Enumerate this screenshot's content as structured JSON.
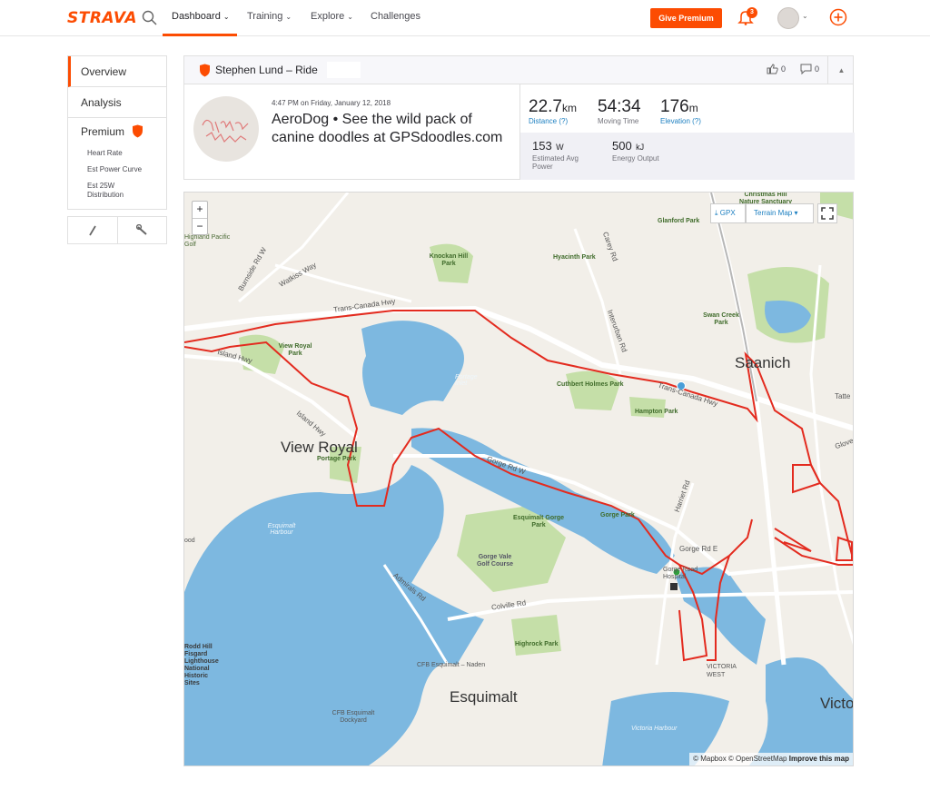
{
  "nav": {
    "logo": "STRAVA",
    "items": [
      "Dashboard",
      "Training",
      "Explore",
      "Challenges"
    ],
    "give_premium": "Give Premium",
    "notification_count": "3",
    "accent": "#fc4c02"
  },
  "sidebar": {
    "items": [
      "Overview",
      "Analysis",
      "Premium"
    ],
    "premium_sub": [
      "Heart Rate",
      "Est Power Curve",
      "Est 25W Distribution"
    ]
  },
  "activity": {
    "athlete_title": "Stephen Lund – Ride",
    "kudos_count": "0",
    "comment_count": "0",
    "date": "4:47 PM on Friday, January 12, 2018",
    "name": "AeroDog • See the wild pack of canine doodles at GPSdoodles.com",
    "stats": {
      "distance": {
        "value": "22.7",
        "unit": "km",
        "label": "Distance (?)"
      },
      "moving_time": {
        "value": "54:34",
        "label": "Moving Time"
      },
      "elevation": {
        "value": "176",
        "unit": "m",
        "label": "Elevation (?)"
      },
      "power": {
        "value": "153",
        "unit": "W",
        "label": "Estimated Avg Power"
      },
      "energy": {
        "value": "500",
        "unit": "kJ",
        "label": "Energy Output"
      }
    }
  },
  "map": {
    "gpx_label": "GPX",
    "terrain_label": "Terrain Map",
    "zoom_in": "+",
    "zoom_out": "−",
    "attribution": "© Mapbox © OpenStreetMap",
    "improve": "Improve this map",
    "labels": {
      "saanich": "Saanich",
      "view_royal": "View Royal",
      "esquimalt": "Esquimalt",
      "victoria": "Victo",
      "victoria_west": "VICTORIA WEST",
      "trans_canada_1": "Trans-Canada Hwy",
      "trans_canada_2": "Trans-Canada Hwy",
      "island_hwy_1": "Island Hwy",
      "island_hwy_2": "Island Hwy",
      "burnside": "Burnside Rd W",
      "watkiss": "Watkiss Way",
      "gorge_rd_w": "Gorge Rd W",
      "gorge_rd_e": "Gorge Rd E",
      "harriet": "Harriet Rd",
      "carey": "Carey Rd",
      "interurban": "Interurban Rd",
      "admirals": "Admirals Rd",
      "colville": "Colville Rd",
      "tatte": "Tatte",
      "glove": "Glove",
      "knockan": "Knockan Hill Park",
      "hyacinth": "Hyacinth Park",
      "glanford": "Glanford Park",
      "swan_creek": "Swan Creek Park",
      "christmas_hill": "Christmas Hill Nature Sanctuary",
      "view_royal_park": "View Royal Park",
      "cuthbert": "Cuthbert Holmes Park",
      "hampton": "Hampton Park",
      "portage_park": "Portage Park",
      "portage_inlet": "Portage Inlet",
      "esq_gorge_park": "Esquimalt Gorge Park",
      "gorge_park": "Gorge Park",
      "gorge_vale": "Gorge Vale Golf Course",
      "highrock": "Highrock Park",
      "gorge_road_hospital": "Gorge Road Hospital",
      "esquimalt_harbour": "Esquimalt Harbour",
      "victoria_harbour": "Victoria Harbour",
      "cfb_naden": "CFB Esquimalt – Naden",
      "cfb_dockyard": "CFB Esquimalt Dockyard",
      "highland_golf": "Highland Pacific Golf",
      "fisgard": "Rodd Hill Fisgard Lighthouse National Historic Sites",
      "wood": "ood"
    },
    "colors": {
      "route": "#e32b1f",
      "water": "#75b6e0",
      "park": "#b9d99a",
      "land": "#f2efe9",
      "road": "#ffffff"
    }
  }
}
